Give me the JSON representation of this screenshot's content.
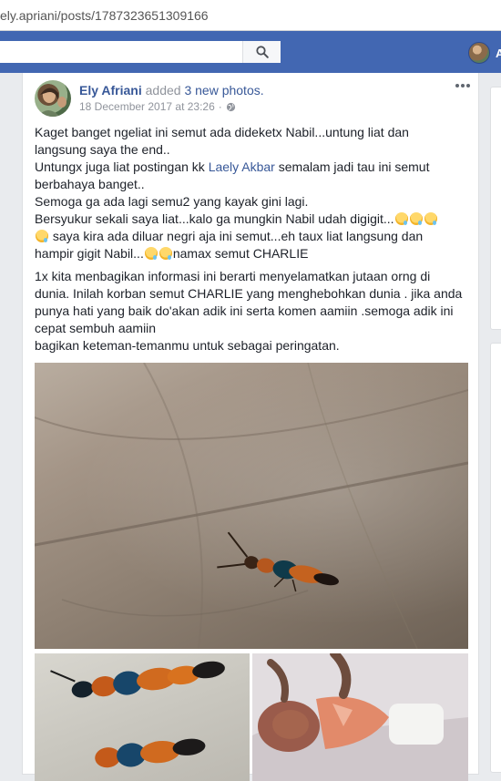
{
  "browser": {
    "url": "ely.apriani/posts/1787323651309166"
  },
  "header": {
    "search_placeholder": "",
    "profile_initial": "A"
  },
  "post": {
    "author": "Ely Afriani",
    "action": "added",
    "photos_link": "3 new photos.",
    "timestamp": "18 December 2017 at 23:26",
    "timestamp_sep": "·",
    "text": {
      "l1": "Kaget banget ngeliat ini semut ada dideketx Nabil...untung liat dan",
      "l2": "langsung saya the end..",
      "l3": "Untungx juga liat postingan kk",
      "l3_link": "Laely Akbar",
      "l3_tail": "semalam jadi tau ini semut",
      "l4": "berbahaya banget..",
      "l5": "Semoga ga ada lagi semu2 yang kayak gini lagi.",
      "l6": "Bersyukur sekali saya liat...kalo ga mungkin Nabil udah digigit...",
      "l7": "saya kira ada diluar negri aja ini semut...eh taux liat langsung dan",
      "l8": "hampir gigit Nabil...",
      "l8_tail": "namax semut CHARLIE",
      "p2": "1x kita menbagikan informasi ini berarti menyelamatkan jutaan orng di dunia. Inilah korban semut CHARLIE yang menghebohkan dunia . jika anda punya hati yang baik do'akan adik ini serta komen aamiin .semoga adik ini cepat sembuh aamiin",
      "p3": "bagikan keteman-temanmu untuk sebagai peringatan."
    }
  }
}
